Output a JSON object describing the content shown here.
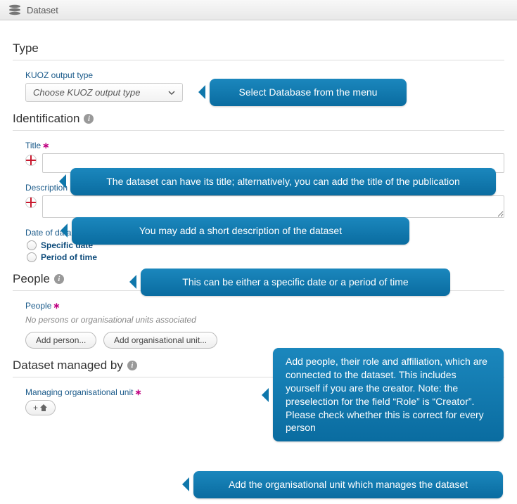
{
  "header": {
    "title": "Dataset"
  },
  "type": {
    "section_title": "Type",
    "kuoz_label": "KUOZ output type",
    "dropdown_placeholder": "Choose KUOZ output type"
  },
  "identification": {
    "section_title": "Identification",
    "title_label": "Title",
    "description_label": "Description",
    "date_label": "Date of data production",
    "specific_date": "Specific date",
    "period_of_time": "Period of time"
  },
  "people": {
    "section_title": "People",
    "people_label": "People",
    "placeholder": "No persons or organisational units associated",
    "add_person": "Add person...",
    "add_org": "Add organisational unit..."
  },
  "managed": {
    "section_title": "Dataset managed by",
    "org_label": "Managing organisational unit",
    "plus": "+"
  },
  "callouts": {
    "c1": "Select Database from the menu",
    "c2": "The dataset can have its title; alternatively, you can add the title of the publication",
    "c3": "You may add a short description of the dataset",
    "c4": "This can be either a specific date or a period of time",
    "c5": "Add people, their role and affiliation, which are connected to the dataset. This includes yourself if you are the creator. Note: the preselection for the field “Role” is “Creator”. Please check whether this is correct for every person",
    "c6": "Add the organisational unit which manages the dataset"
  }
}
